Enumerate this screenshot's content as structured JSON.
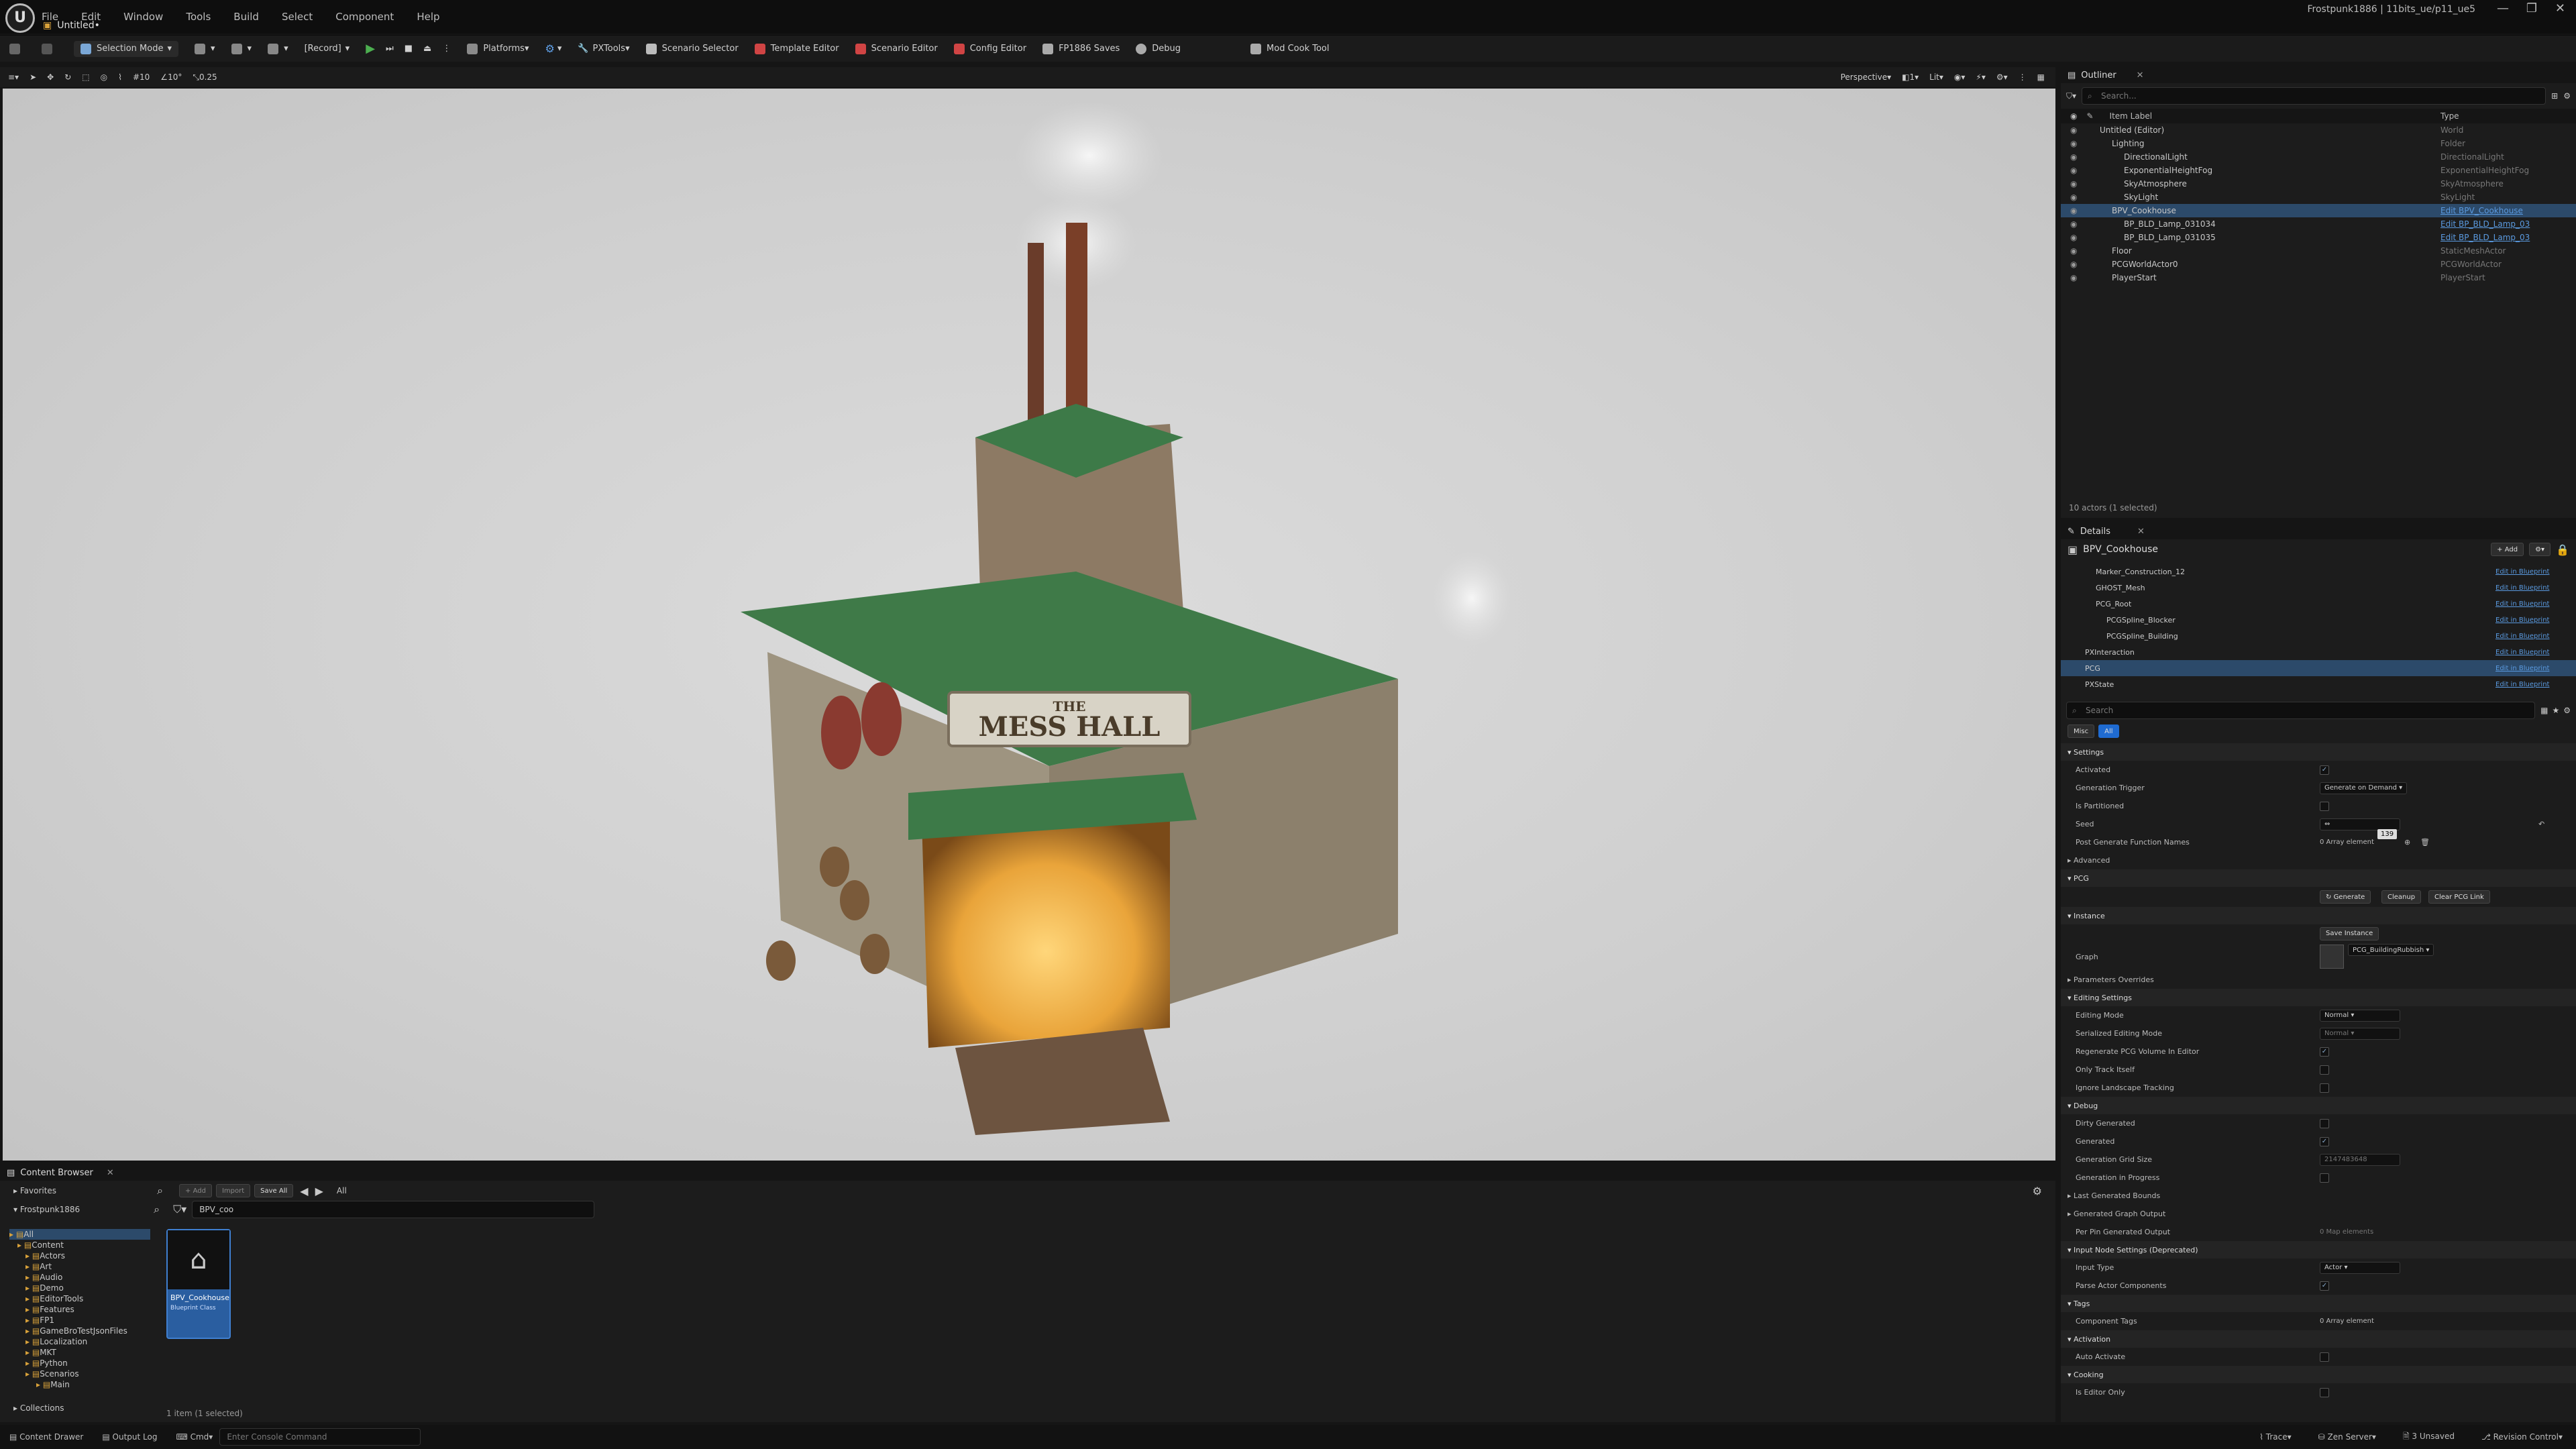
{
  "menubar": {
    "logo": "U",
    "items": [
      "File",
      "Edit",
      "Window",
      "Tools",
      "Build",
      "Select",
      "Component",
      "Help"
    ],
    "project": "Frostpunk1886 | 11bits_ue/p11_ue5",
    "tab": "Untitled•",
    "window_controls": [
      "—",
      "❐",
      "✕"
    ]
  },
  "toolbar": {
    "mode": "Selection Mode",
    "record": "[Record]",
    "platforms": "Platforms",
    "pxtools": "PXTools",
    "items": [
      "Scenario Selector",
      "Template Editor",
      "Scenario Editor",
      "Config Editor",
      "FP1886 Saves",
      "Debug",
      "Mod Cook Tool"
    ]
  },
  "viewport": {
    "perspective": "Perspective",
    "lit": "Lit",
    "grid": "10",
    "angle": "10°",
    "scale": "0.25",
    "sign": "THE MESS HALL",
    "sign_top": "THE",
    "sign_main": "MESS HALL",
    "cam_speed": "1"
  },
  "outliner": {
    "tab": "Outliner",
    "search": "Search...",
    "col_label": "Item Label",
    "col_type": "Type",
    "rows": [
      {
        "name": "Untitled (Editor)",
        "type": "World",
        "indent": 1,
        "link": false,
        "sel": false
      },
      {
        "name": "Lighting",
        "type": "Folder",
        "indent": 2,
        "link": false,
        "sel": false
      },
      {
        "name": "DirectionalLight",
        "type": "DirectionalLight",
        "indent": 3,
        "link": false,
        "sel": false
      },
      {
        "name": "ExponentialHeightFog",
        "type": "ExponentialHeightFog",
        "indent": 3,
        "link": false,
        "sel": false
      },
      {
        "name": "SkyAtmosphere",
        "type": "SkyAtmosphere",
        "indent": 3,
        "link": false,
        "sel": false
      },
      {
        "name": "SkyLight",
        "type": "SkyLight",
        "indent": 3,
        "link": false,
        "sel": false
      },
      {
        "name": "BPV_Cookhouse",
        "type": "Edit BPV_Cookhouse",
        "indent": 2,
        "link": true,
        "sel": true
      },
      {
        "name": "BP_BLD_Lamp_031034",
        "type": "Edit BP_BLD_Lamp_03",
        "indent": 3,
        "link": true,
        "sel": false
      },
      {
        "name": "BP_BLD_Lamp_031035",
        "type": "Edit BP_BLD_Lamp_03",
        "indent": 3,
        "link": true,
        "sel": false
      },
      {
        "name": "Floor",
        "type": "StaticMeshActor",
        "indent": 2,
        "link": false,
        "sel": false
      },
      {
        "name": "PCGWorldActor0",
        "type": "PCGWorldActor",
        "indent": 2,
        "link": false,
        "sel": false
      },
      {
        "name": "PlayerStart",
        "type": "PlayerStart",
        "indent": 2,
        "link": false,
        "sel": false
      }
    ],
    "footer": "10 actors (1 selected)"
  },
  "details": {
    "tab": "Details",
    "actor": "BPV_Cookhouse",
    "add": "+ Add",
    "search": "Search",
    "filters": [
      "Misc",
      "All"
    ],
    "edit_link": "Edit in Blueprint",
    "components": [
      {
        "name": "Marker_Construction_12",
        "indent": 2,
        "sel": false
      },
      {
        "name": "GHOST_Mesh",
        "indent": 2,
        "sel": false
      },
      {
        "name": "PCG_Root",
        "indent": 2,
        "sel": false
      },
      {
        "name": "PCGSpline_Blocker",
        "indent": 3,
        "sel": false
      },
      {
        "name": "PCGSpline_Building",
        "indent": 3,
        "sel": false
      },
      {
        "name": "PXInteraction",
        "indent": 1,
        "sel": false
      },
      {
        "name": "PCG",
        "indent": 1,
        "sel": true
      },
      {
        "name": "PXState",
        "indent": 1,
        "sel": false
      }
    ],
    "settings": {
      "section": "Settings",
      "activated": "Activated",
      "gen_trigger": "Generation Trigger",
      "gen_trigger_val": "Generate on Demand",
      "partitioned": "Is Partitioned",
      "seed": "Seed",
      "seed_tip": "139",
      "post_gen": "Post Generate Function Names",
      "post_gen_val": "0 Array element",
      "advanced": "Advanced"
    },
    "pcg": {
      "section": "PCG",
      "generate": "Generate",
      "cleanup": "Cleanup",
      "clear_link": "Clear PCG Link"
    },
    "instance": {
      "section": "Instance",
      "save": "Save Instance",
      "graph": "Graph",
      "graph_val": "PCG_BuildingRubbish",
      "param_overrides": "Parameters Overrides"
    },
    "editing": {
      "section": "Editing Settings",
      "mode": "Editing Mode",
      "mode_val": "Normal",
      "ser_mode": "Serialized Editing Mode",
      "ser_mode_val": "Normal",
      "regen": "Regenerate PCG Volume In Editor",
      "only_track": "Only Track Itself",
      "ignore_land": "Ignore Landscape Tracking"
    },
    "debug": {
      "section": "Debug",
      "dirty": "Dirty Generated",
      "generated": "Generated",
      "grid": "Generation Grid Size",
      "grid_val": "2147483648",
      "in_progress": "Generation in Progress",
      "last_bounds": "Last Generated Bounds",
      "graph_out": "Generated Graph Output",
      "per_pin": "Per Pin Generated Output",
      "per_pin_val": "0 Map elements"
    },
    "input": {
      "section": "Input Node Settings (Deprecated)",
      "type": "Input Type",
      "type_val": "Actor",
      "parse": "Parse Actor Components"
    },
    "tags": {
      "section": "Tags",
      "comp_tags": "Component Tags",
      "comp_tags_val": "0 Array element"
    },
    "activation": {
      "section": "Activation",
      "auto": "Auto Activate"
    },
    "cooking": {
      "section": "Cooking",
      "editor_only": "Is Editor Only"
    }
  },
  "content_browser": {
    "tab": "Content Browser",
    "add": "+ Add",
    "import": "Import",
    "save_all": "Save All",
    "path": "All",
    "favorites": "Favorites",
    "project": "Frostpunk1886",
    "filter": "BPV_coo",
    "tree": [
      "All",
      "Content",
      "Actors",
      "Art",
      "Audio",
      "Demo",
      "EditorTools",
      "Features",
      "FP1",
      "GameBroTestJsonFiles",
      "Localization",
      "MKT",
      "Python",
      "Scenarios",
      "Main"
    ],
    "asset_name": "BPV_Cookhouse",
    "asset_class": "Blueprint Class",
    "count": "1 item (1 selected)",
    "collections": "Collections"
  },
  "statusbar": {
    "content_drawer": "Content Drawer",
    "output_log": "Output Log",
    "cmd": "Cmd",
    "console": "Enter Console Command",
    "trace": "Trace",
    "zen": "Zen Server",
    "unsaved": "3 Unsaved",
    "revision": "Revision Control"
  }
}
